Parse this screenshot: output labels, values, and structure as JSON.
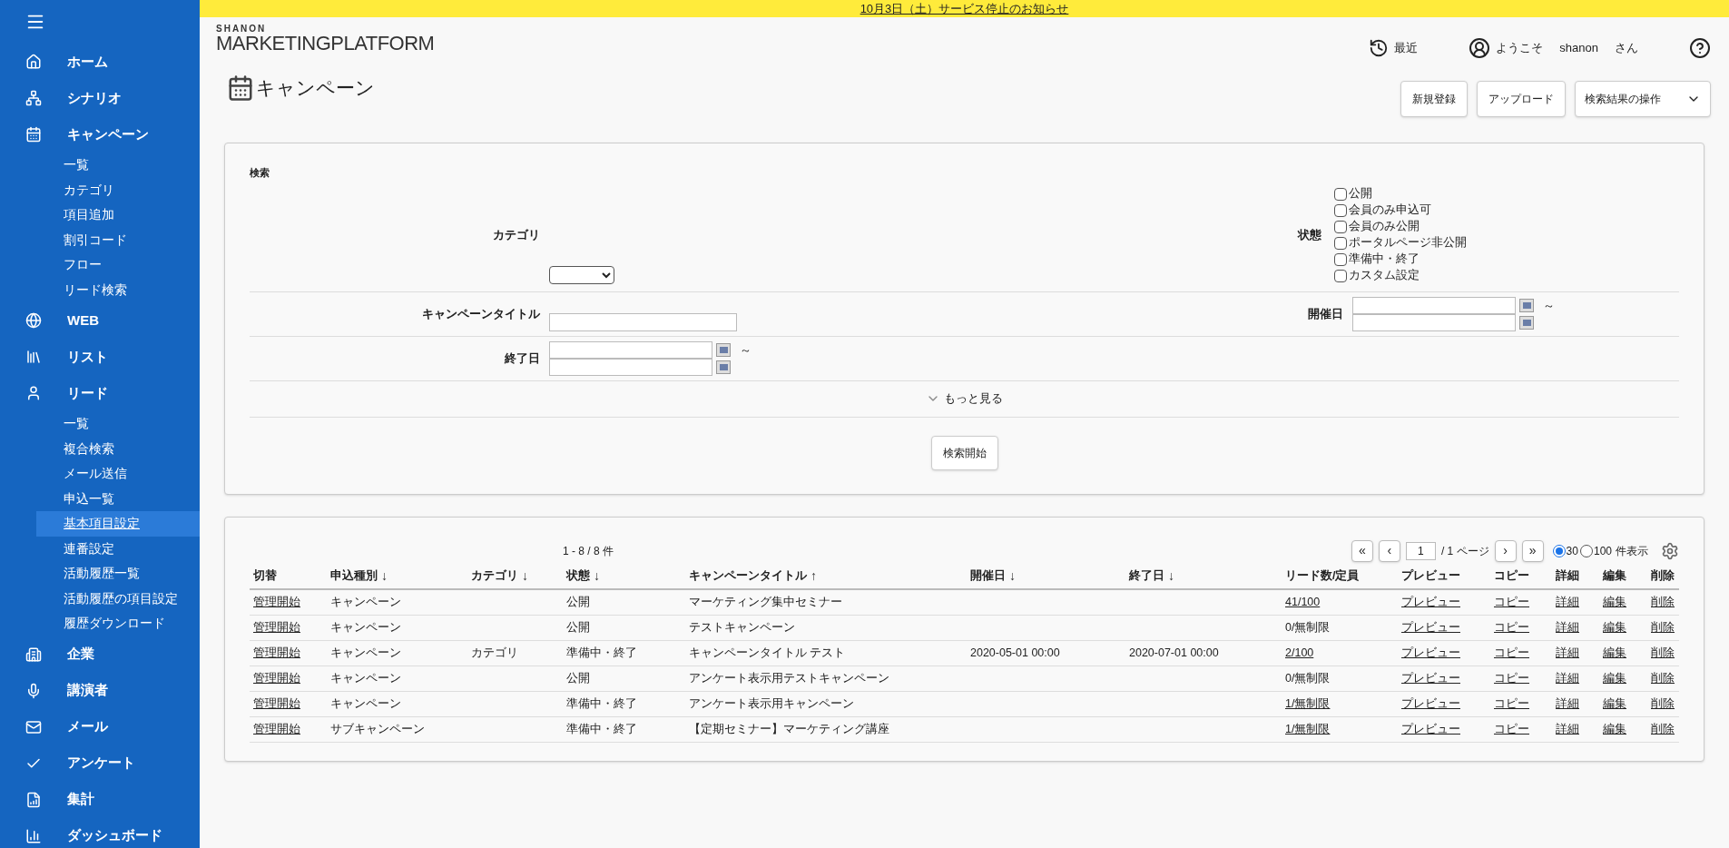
{
  "banner": {
    "text": "10月3日（土）サービス停止のお知らせ"
  },
  "sidebar": {
    "items": [
      {
        "label": "ホーム"
      },
      {
        "label": "シナリオ"
      },
      {
        "label": "キャンペーン",
        "children": [
          {
            "label": "一覧",
            "selected": false
          },
          {
            "label": "カテゴリ",
            "selected": false
          },
          {
            "label": "項目追加",
            "selected": false
          },
          {
            "label": "割引コード",
            "selected": false
          },
          {
            "label": "フロー",
            "selected": false
          },
          {
            "label": "リード検索",
            "selected": false
          }
        ]
      },
      {
        "label": "WEB"
      },
      {
        "label": "リスト"
      },
      {
        "label": "リード",
        "children": [
          {
            "label": "一覧",
            "selected": false
          },
          {
            "label": "複合検索",
            "selected": false
          },
          {
            "label": "メール送信",
            "selected": false
          },
          {
            "label": "申込一覧",
            "selected": false
          },
          {
            "label": "基本項目設定",
            "selected": true
          },
          {
            "label": "連番設定",
            "selected": false
          },
          {
            "label": "活動履歴一覧",
            "selected": false
          },
          {
            "label": "活動履歴の項目設定",
            "selected": false
          },
          {
            "label": "履歴ダウンロード",
            "selected": false
          }
        ]
      },
      {
        "label": "企業"
      },
      {
        "label": "講演者"
      },
      {
        "label": "メール"
      },
      {
        "label": "アンケート"
      },
      {
        "label": "集計"
      },
      {
        "label": "ダッシュボード"
      }
    ]
  },
  "header": {
    "logo_top": "SHANON",
    "logo_main": "MARKETINGPLATFORM",
    "recent": "最近",
    "welcome": "ようこそ",
    "user": "shanon",
    "honorific": "さん"
  },
  "page": {
    "title": "キャンペーン",
    "buttons": [
      "新規登録",
      "アップロード"
    ],
    "dropdown": "検索結果の操作"
  },
  "search": {
    "title": "検索",
    "category_label": "カテゴリ",
    "status_label": "状態",
    "statuses": [
      {
        "label": "公開",
        "checked": false
      },
      {
        "label": "会員のみ申込可",
        "checked": false
      },
      {
        "label": "会員のみ公開",
        "checked": false
      },
      {
        "label": "ポータルページ非公開",
        "checked": false
      },
      {
        "label": "準備中・終了",
        "checked": false
      },
      {
        "label": "カスタム設定",
        "checked": false
      }
    ],
    "title_label": "キャンペーンタイトル",
    "start_label": "開催日",
    "end_label": "終了日",
    "tilde": "～",
    "more": "もっと見る",
    "submit": "検索開始"
  },
  "results": {
    "count": "1 - 8 / 8 件",
    "page": "1",
    "page_suffix": "/ 1 ページ",
    "first": "«",
    "prev": "‹",
    "next": "›",
    "last": "»",
    "per_page": [
      {
        "label": "30",
        "selected": true
      },
      {
        "label": "100",
        "selected": false
      }
    ],
    "per_page_suffix": "件表示",
    "columns": [
      {
        "label": "切替"
      },
      {
        "label": "申込種別",
        "arrow": "↓"
      },
      {
        "label": "カテゴリ",
        "arrow": "↓"
      },
      {
        "label": "状態",
        "arrow": "↓"
      },
      {
        "label": "キャンペーンタイトル",
        "arrow": "↑"
      },
      {
        "label": "開催日",
        "arrow": "↓"
      },
      {
        "label": "終了日",
        "arrow": "↓"
      },
      {
        "label": "リード数/定員"
      },
      {
        "label": "プレビュー"
      },
      {
        "label": "コピー"
      },
      {
        "label": "詳細"
      },
      {
        "label": "編集"
      },
      {
        "label": "削除"
      }
    ],
    "rows": [
      {
        "toggle": "管理開始",
        "type": "キャンペーン",
        "status": "公開",
        "title": "マーケティング集中セミナー",
        "leads": "41/100",
        "leads_link": true,
        "preview": "プレビュー",
        "copy": "コピー",
        "detail": "詳細",
        "edit": "編集",
        "delete": "削除"
      },
      {
        "toggle": "管理開始",
        "type": "キャンペーン",
        "status": "公開",
        "title": "テストキャンペーン",
        "leads": "0/無制限",
        "leads_link": false,
        "preview": "プレビュー",
        "copy": "コピー",
        "detail": "詳細",
        "edit": "編集",
        "delete": "削除"
      },
      {
        "toggle": "管理開始",
        "type": "キャンペーン",
        "category": "カテゴリ",
        "status": "準備中・終了",
        "title": "キャンペーンタイトル テスト",
        "start": "2020-05-01 00:00",
        "end": "2020-07-01 00:00",
        "leads": "2/100",
        "leads_link": true,
        "preview": "プレビュー",
        "copy": "コピー",
        "detail": "詳細",
        "edit": "編集",
        "delete": "削除"
      },
      {
        "toggle": "管理開始",
        "type": "キャンペーン",
        "status": "公開",
        "title": "アンケート表示用テストキャンペーン",
        "leads": "0/無制限",
        "leads_link": false,
        "preview": "プレビュー",
        "copy": "コピー",
        "detail": "詳細",
        "edit": "編集",
        "delete": "削除"
      },
      {
        "toggle": "管理開始",
        "type": "キャンペーン",
        "status": "準備中・終了",
        "title": "アンケート表示用キャンペーン",
        "leads": "1/無制限",
        "leads_link": true,
        "preview": "プレビュー",
        "copy": "コピー",
        "detail": "詳細",
        "edit": "編集",
        "delete": "削除"
      },
      {
        "toggle": "管理開始",
        "type": "サブキャンペーン",
        "status": "準備中・終了",
        "title": "【定期セミナー】マーケティング講座",
        "leads": "1/無制限",
        "leads_link": true,
        "preview": "プレビュー",
        "copy": "コピー",
        "detail": "詳細",
        "edit": "編集",
        "delete": "削除"
      }
    ]
  }
}
